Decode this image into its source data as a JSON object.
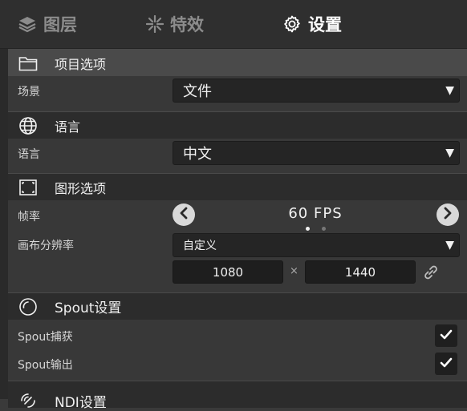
{
  "tabs": [
    {
      "label": "图层",
      "icon": "layers-icon",
      "active": false
    },
    {
      "label": "特效",
      "icon": "sparkle-icon",
      "active": false
    },
    {
      "label": "设置",
      "icon": "gear-icon",
      "active": true
    }
  ],
  "sections": {
    "project": {
      "title": "项目选项",
      "icon": "folder-icon"
    },
    "language": {
      "title": "语言",
      "icon": "globe-icon"
    },
    "graphics": {
      "title": "图形选项",
      "icon": "screen-frame-icon"
    },
    "spout": {
      "title": "Spout设置",
      "icon": "spout-icon"
    },
    "ndi": {
      "title": "NDI设置",
      "icon": "ndi-icon"
    }
  },
  "project": {
    "scene_label": "场景",
    "scene_value": "文件"
  },
  "language": {
    "language_label": "语言",
    "language_value": "中文"
  },
  "graphics": {
    "framerate_label": "帧率",
    "framerate_value": "60 FPS",
    "framerate_page": 1,
    "framerate_pages": 2,
    "resolution_label": "画布分辨率",
    "resolution_value": "自定义",
    "width": "1080",
    "times": "×",
    "height": "1440"
  },
  "spout": {
    "capture_label": "Spout捕获",
    "capture_checked": true,
    "output_label": "Spout输出",
    "output_checked": true
  },
  "dropdown_arrow": "▼",
  "colors": {
    "tab_active": "#ffffff",
    "tab_inactive": "#8c8c8c",
    "section_bg": "#2c2c2c",
    "field_bg": "#252525"
  }
}
